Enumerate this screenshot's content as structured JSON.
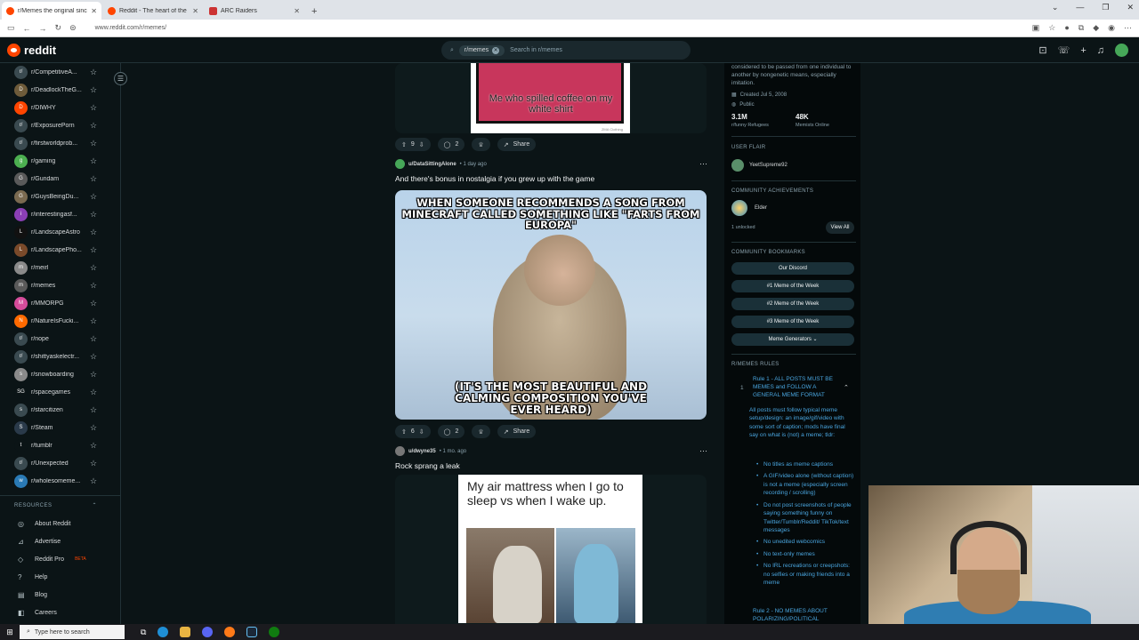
{
  "browser": {
    "tabs": [
      {
        "title": "r/Memes the original since 2008",
        "active": true
      },
      {
        "title": "Reddit - The heart of the internet",
        "active": false
      },
      {
        "title": "ARC Raiders",
        "active": false
      }
    ],
    "new_tab_label": "+",
    "url": "www.reddit.com/r/memes/"
  },
  "header": {
    "logo_text": "reddit",
    "search_chip": "r/memes",
    "search_placeholder": "Search in r/memes"
  },
  "sidebar": {
    "communities": [
      {
        "name": "r/CompetitiveA...",
        "icon": "r/",
        "color": "#3a4a50"
      },
      {
        "name": "r/DeadlockTheG...",
        "icon": "D",
        "color": "#6e5b3a"
      },
      {
        "name": "r/DIWHY",
        "icon": "D",
        "color": "#ff4500"
      },
      {
        "name": "r/ExposurePorn",
        "icon": "r/",
        "color": "#3a4a50"
      },
      {
        "name": "r/firstworldprob...",
        "icon": "r/",
        "color": "#3a4a50"
      },
      {
        "name": "r/gaming",
        "icon": "g",
        "color": "#4caf50"
      },
      {
        "name": "r/Gundam",
        "icon": "G",
        "color": "#5a5a5a"
      },
      {
        "name": "r/GuysBeingDu...",
        "icon": "G",
        "color": "#7a6a50"
      },
      {
        "name": "r/interestingasf...",
        "icon": "i",
        "color": "#8b3fb5"
      },
      {
        "name": "r/LandscapeAstro",
        "icon": "L",
        "color": "#111"
      },
      {
        "name": "r/LandscapePho...",
        "icon": "L",
        "color": "#7a4a2a"
      },
      {
        "name": "r/meirl",
        "icon": "m",
        "color": "#8a8a8a"
      },
      {
        "name": "r/memes",
        "icon": "m",
        "color": "#5a5a5a"
      },
      {
        "name": "r/MMORPG",
        "icon": "M",
        "color": "#d64c9b"
      },
      {
        "name": "r/NatureIsFucki...",
        "icon": "N",
        "color": "#ff6a00"
      },
      {
        "name": "r/nope",
        "icon": "r/",
        "color": "#3a4a50"
      },
      {
        "name": "r/shittyaskelectr...",
        "icon": "r/",
        "color": "#3a4a50"
      },
      {
        "name": "r/snowboarding",
        "icon": "s",
        "color": "#8a8a8a"
      },
      {
        "name": "r/spacegames",
        "icon": "SG",
        "color": "#0b1416"
      },
      {
        "name": "r/starcitizen",
        "icon": "s",
        "color": "#3a4a50"
      },
      {
        "name": "r/Steam",
        "icon": "S",
        "color": "#2a3a4a"
      },
      {
        "name": "r/tumblr",
        "icon": "t",
        "color": "#0b1416"
      },
      {
        "name": "r/Unexpected",
        "icon": "r/",
        "color": "#3a4a50"
      },
      {
        "name": "r/wholesomeme...",
        "icon": "w",
        "color": "#2a7ab5"
      }
    ],
    "resources_label": "RESOURCES",
    "resources": [
      {
        "label": "About Reddit",
        "icon": "◎"
      },
      {
        "label": "Advertise",
        "icon": "⊿"
      },
      {
        "label": "Reddit Pro",
        "icon": "◇",
        "badge": "BETA"
      },
      {
        "label": "Help",
        "icon": "?"
      },
      {
        "label": "Blog",
        "icon": "▤"
      },
      {
        "label": "Careers",
        "icon": "◧"
      }
    ]
  },
  "feed": {
    "post1": {
      "votes": "9",
      "comments": "2",
      "share": "Share",
      "caption": "Me who spilled coffee on my white shirt",
      "watermark": "ZMA Clothing"
    },
    "post2": {
      "user": "u/DataSittingAlone",
      "time": "• 1 day ago",
      "title": "And there's bonus in nostalgia if you grew up with the game",
      "meme_top": "WHEN SOMEONE RECOMMENDS A SONG FROM MINECRAFT CALLED SOMETHING LIKE \"FARTS FROM EUROPA\"",
      "meme_bottom": "(IT'S THE MOST BEAUTIFUL AND CALMING COMPOSITION YOU'VE EVER HEARD)",
      "votes": "6",
      "comments": "2",
      "share": "Share"
    },
    "post3": {
      "user": "u/dwyne35",
      "time": "• 1 mo. ago",
      "title": "Rock sprang a leak",
      "meme_text": "My air mattress when I go to sleep vs when I wake up."
    }
  },
  "right_panel": {
    "description": "considered to be passed from one individual to another by nongenetic means, especially imitation.",
    "created": "Created Jul 5, 2008",
    "visibility": "Public",
    "members_count": "3.1M",
    "members_label": "r/funny Refugees",
    "online_count": "48K",
    "online_label": "Memists Online",
    "user_flair_label": "USER FLAIR",
    "flair_name": "YeetSupreme92",
    "achievements_label": "COMMUNITY ACHIEVEMENTS",
    "achievement_name": "Elder",
    "unlocked": "1 unlocked",
    "view_all": "View All",
    "bookmarks_label": "COMMUNITY BOOKMARKS",
    "bookmarks": [
      "Our Discord",
      "#1 Meme of the Week",
      "#2 Meme of the Week",
      "#3 Meme of the Week",
      "Meme Generators"
    ],
    "rules_label": "R/MEMES RULES",
    "rule1_num": "1",
    "rule1_title": "Rule 1 - ALL POSTS MUST BE MEMES and FOLLOW A GENERAL MEME FORMAT",
    "rule1_body": "All posts must follow typical meme setup/design: an image/gif/video with some sort of caption; mods have final say on what is (not) a meme; tldr:",
    "rule1_bullets": [
      "No titles as meme captions",
      "A GIF/video alone (without caption) is not a meme (especially screen recording / scrolling)",
      "Do not post screenshots of people saying something funny on Twitter/Tumblr/Reddit/ TikTok/text messages",
      "No unedited webcomics",
      "No text-only memes",
      "No IRL recreations or creepshots: no selfies or making friends into a meme"
    ],
    "rule2_title": "Rule 2 - NO MEMES ABOUT POLARIZING/POLITICAL"
  },
  "taskbar": {
    "search_placeholder": "Type here to search"
  }
}
